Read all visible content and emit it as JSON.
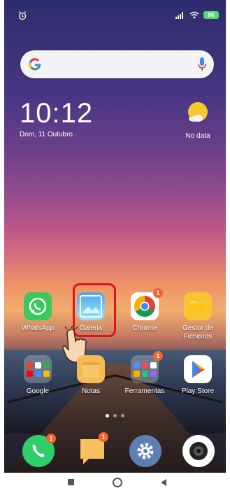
{
  "status_bar": {
    "battery_level": "86"
  },
  "search": {
    "provider_icon": "google-icon",
    "mic_icon": "mic-icon"
  },
  "clock": {
    "time": "10:12",
    "date": "Dom, 11 Outubro"
  },
  "weather": {
    "label": "No data",
    "icon": "sun-cloud-icon"
  },
  "apps_row1": [
    {
      "label": "WhatsApp",
      "icon": "whatsapp-icon"
    },
    {
      "label": "Galeria",
      "icon": "gallery-icon"
    },
    {
      "label": "Chrome",
      "icon": "chrome-icon",
      "badge": "1"
    },
    {
      "label": "Gestor de Ficheiros",
      "icon": "folder-icon"
    }
  ],
  "apps_row2": [
    {
      "label": "Google",
      "icon": "folder-icon"
    },
    {
      "label": "Notas",
      "icon": "notes-icon"
    },
    {
      "label": "Ferramentas",
      "icon": "folder-icon",
      "badge": "1"
    },
    {
      "label": "Play Store",
      "icon": "play-store-icon"
    }
  ],
  "dock": [
    {
      "name": "phone",
      "icon": "phone-icon",
      "badge": "1"
    },
    {
      "name": "messages",
      "icon": "message-icon",
      "badge": "1"
    },
    {
      "name": "settings",
      "icon": "gear-icon"
    },
    {
      "name": "camera",
      "icon": "camera-icon"
    }
  ],
  "colors": {
    "highlight": "#e0121f",
    "badge": "#f5642e",
    "whatsapp": "#3cc85c"
  }
}
